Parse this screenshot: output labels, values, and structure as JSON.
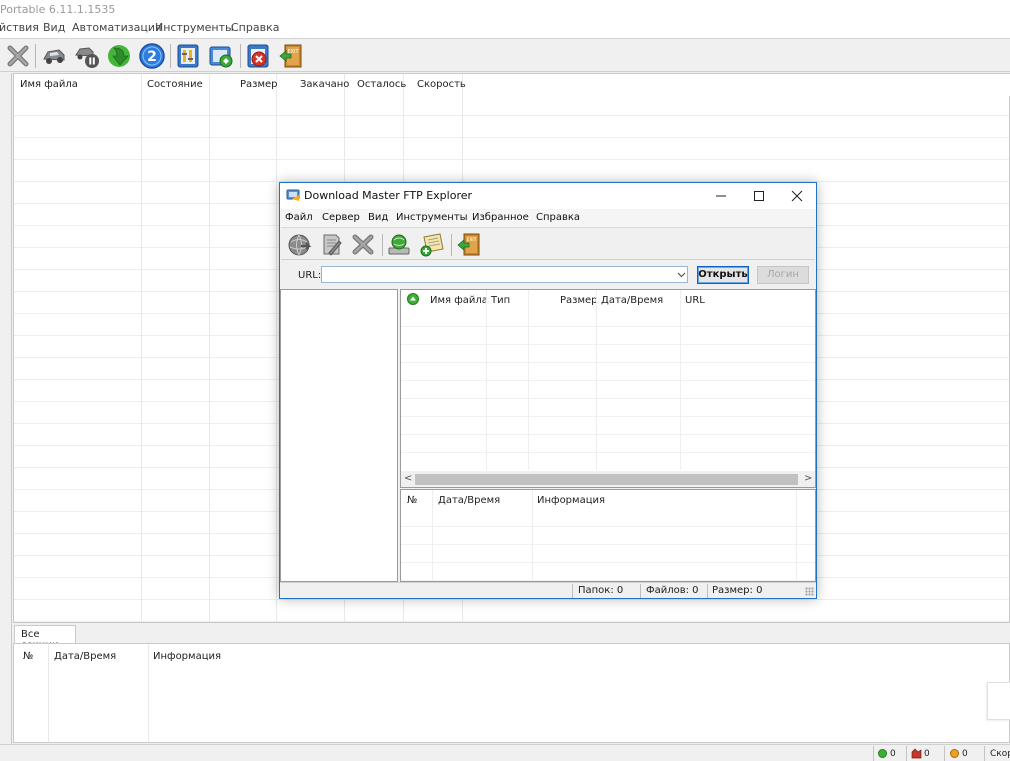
{
  "app": {
    "title": "Portable 6.11.1.1535",
    "menu": [
      "йствия",
      "Вид",
      "Автоматизация",
      "Инструменты",
      "Справка"
    ]
  },
  "toolbar": {
    "icons": [
      "delete-icon",
      "car-icon",
      "pause-car-icon",
      "download-arrow-icon",
      "sections-2-icon",
      "settings-icon",
      "site-manager-icon",
      "scheduler-icon",
      "exit-icon"
    ]
  },
  "downloads_table": {
    "columns": [
      "Имя файла",
      "Состояние",
      "Размер",
      "Закачано",
      "Осталось",
      "Скорость"
    ]
  },
  "bottom_tabs": [
    "Все секции"
  ],
  "log_table": {
    "columns": [
      "№",
      "Дата/Время",
      "Информация"
    ]
  },
  "statusbar": {
    "active_count": "0",
    "error_count": "0",
    "paused_count": "0",
    "speed_label": "Скор"
  },
  "ftp_dialog": {
    "title": "Download Master FTP Explorer",
    "menu": [
      "Файл",
      "Сервер",
      "Вид",
      "Инструменты",
      "Избранное",
      "Справка"
    ],
    "toolbar_icons": [
      "connect-icon",
      "edit-icon",
      "delete-icon",
      "download-icon",
      "add-favorite-icon",
      "exit-icon"
    ],
    "url_label": "URL:",
    "url_value": "",
    "open_button": "Открыть",
    "login_button": "Логин",
    "file_list_columns": [
      "Имя файла",
      "Тип",
      "Размер",
      "Дата/Время",
      "URL"
    ],
    "log_columns": [
      "№",
      "Дата/Время",
      "Информация"
    ],
    "status": {
      "folders": "Папок: 0",
      "files": "Файлов: 0",
      "size": "Размер: 0"
    }
  },
  "colors": {
    "accent": "#1e73c7",
    "active": "#3cb034",
    "error": "#c0392b",
    "paused": "#f0a020"
  }
}
